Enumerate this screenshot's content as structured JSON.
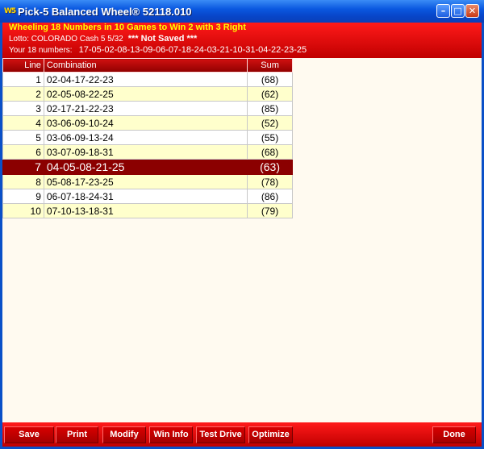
{
  "window": {
    "title": "Pick-5 Balanced Wheel® 52118.010",
    "icon_text": "W5",
    "minimize_glyph": "–",
    "maximize_glyph": "□",
    "close_glyph": "✕"
  },
  "header": {
    "line1": "Wheeling 18 Numbers in 10 Games to Win 2 with 3 Right",
    "lotto": "Lotto: COLORADO Cash 5 5/32",
    "not_saved": "*** Not Saved ***",
    "numbers_label": "Your 18 numbers:",
    "numbers": "17-05-02-08-13-09-06-07-18-24-03-21-10-31-04-22-23-25"
  },
  "table": {
    "columns": [
      "Line",
      "Combination",
      "Sum"
    ],
    "rows": [
      {
        "line": "1",
        "combination": "02-04-17-22-23",
        "sum": "(68)"
      },
      {
        "line": "2",
        "combination": "02-05-08-22-25",
        "sum": "(62)"
      },
      {
        "line": "3",
        "combination": "02-17-21-22-23",
        "sum": "(85)"
      },
      {
        "line": "4",
        "combination": "03-06-09-10-24",
        "sum": "(52)"
      },
      {
        "line": "5",
        "combination": "03-06-09-13-24",
        "sum": "(55)"
      },
      {
        "line": "6",
        "combination": "03-07-09-18-31",
        "sum": "(68)"
      },
      {
        "line": "7",
        "combination": "04-05-08-21-25",
        "sum": "(63)"
      },
      {
        "line": "8",
        "combination": "05-08-17-23-25",
        "sum": "(78)"
      },
      {
        "line": "9",
        "combination": "06-07-18-24-31",
        "sum": "(86)"
      },
      {
        "line": "10",
        "combination": "07-10-13-18-31",
        "sum": "(79)"
      }
    ],
    "selected_row": 7
  },
  "buttons": {
    "save": "Save",
    "print": "Print",
    "modify": "Modify",
    "win_info": "Win Info",
    "test_drive": "Test Drive",
    "optimize": "Optimize",
    "done": "Done"
  },
  "colors": {
    "titlebar": "#0a58e0",
    "header_red": "#e00000",
    "selected_row": "#8b0000",
    "even_row": "#ffffcc",
    "background": "#fffaf0",
    "header_highlight": "#ffff00"
  }
}
